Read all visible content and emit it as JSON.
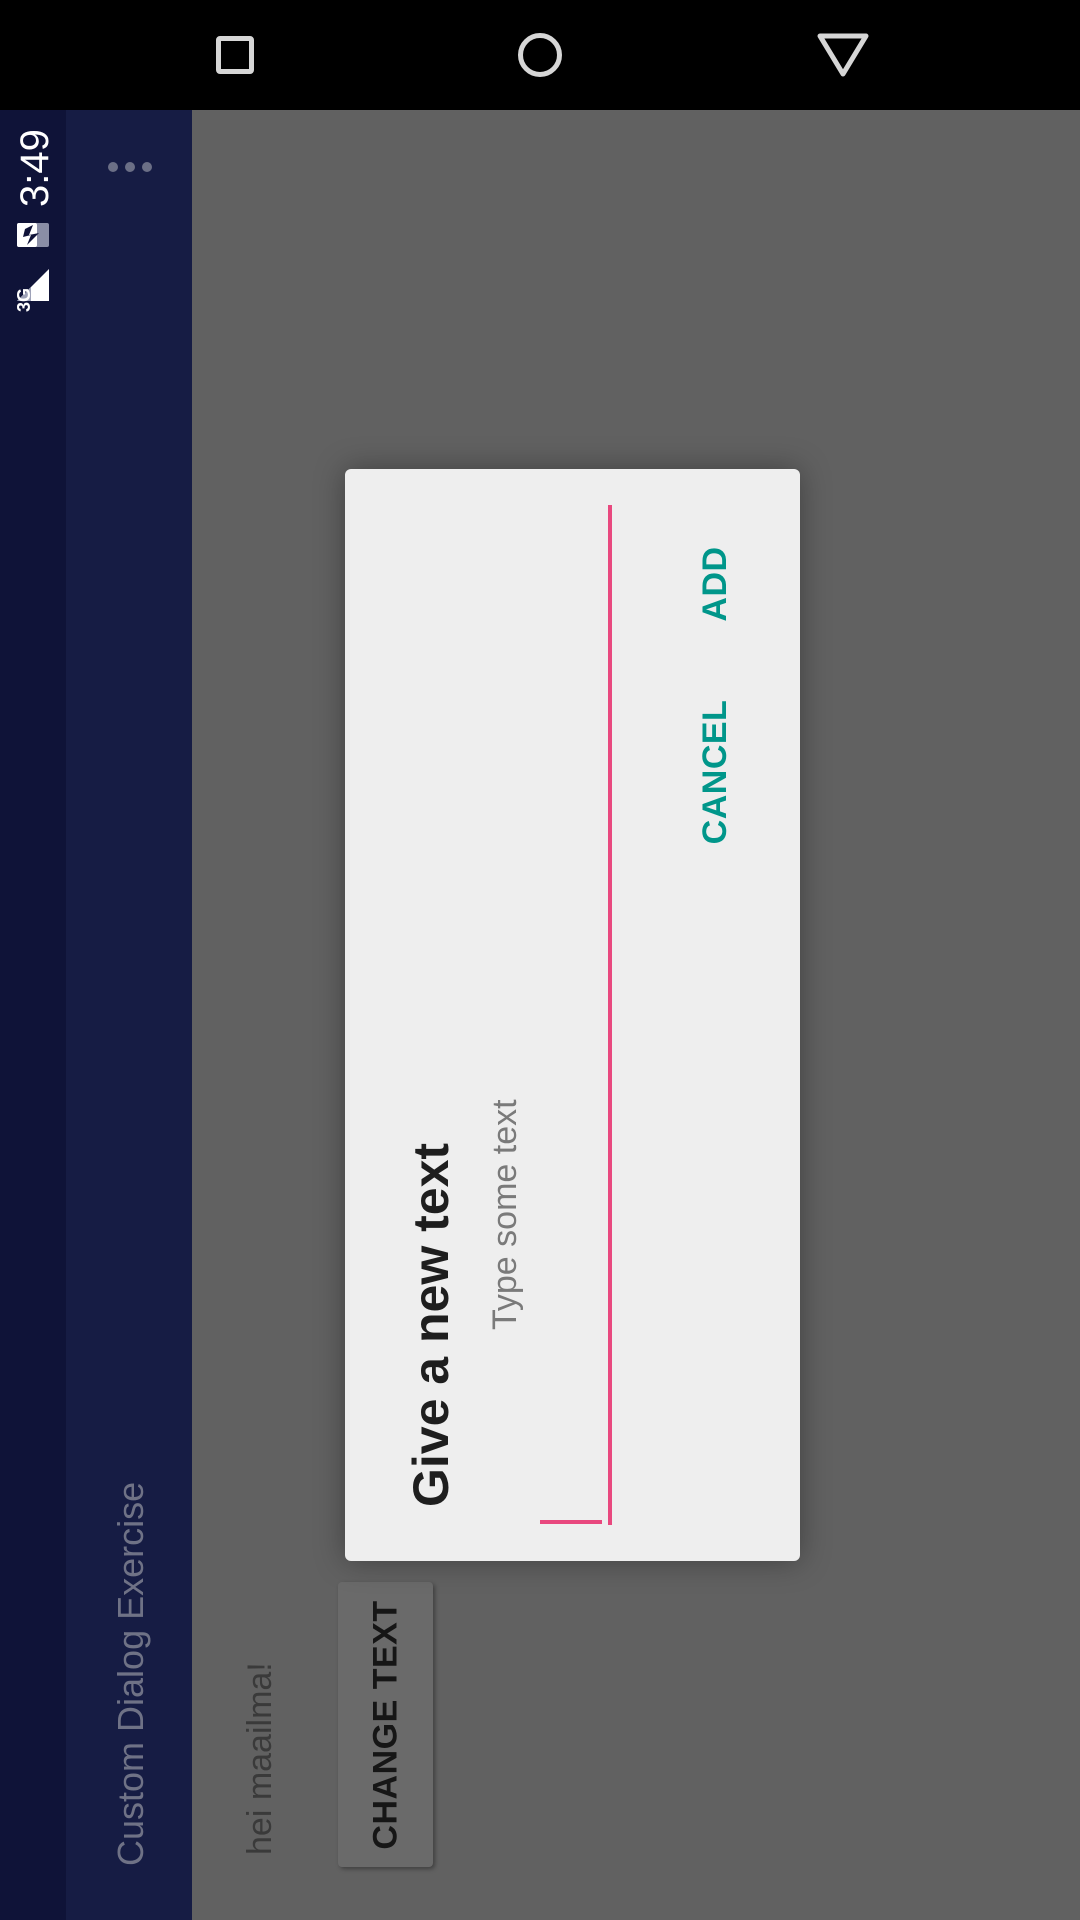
{
  "status_bar": {
    "time": "3:49",
    "network": "3G"
  },
  "app_bar": {
    "title": "Custom Dialog Exercise"
  },
  "content": {
    "message": "hei maailma!",
    "change_button_label": "CHANGE TEXT"
  },
  "dialog": {
    "title": "Give a new text",
    "input": {
      "value": "",
      "placeholder": "Type some text"
    },
    "cancel_label": "CANCEL",
    "add_label": "ADD"
  },
  "nav_bar": {
    "icons": [
      "recents-icon",
      "home-icon",
      "back-icon"
    ]
  },
  "colors": {
    "status_bar": "#0f1338",
    "app_bar": "#161c44",
    "scrim": "#616161",
    "dialog_bg": "#eeeeee",
    "accent": "#e8487e",
    "action": "#00968a"
  }
}
